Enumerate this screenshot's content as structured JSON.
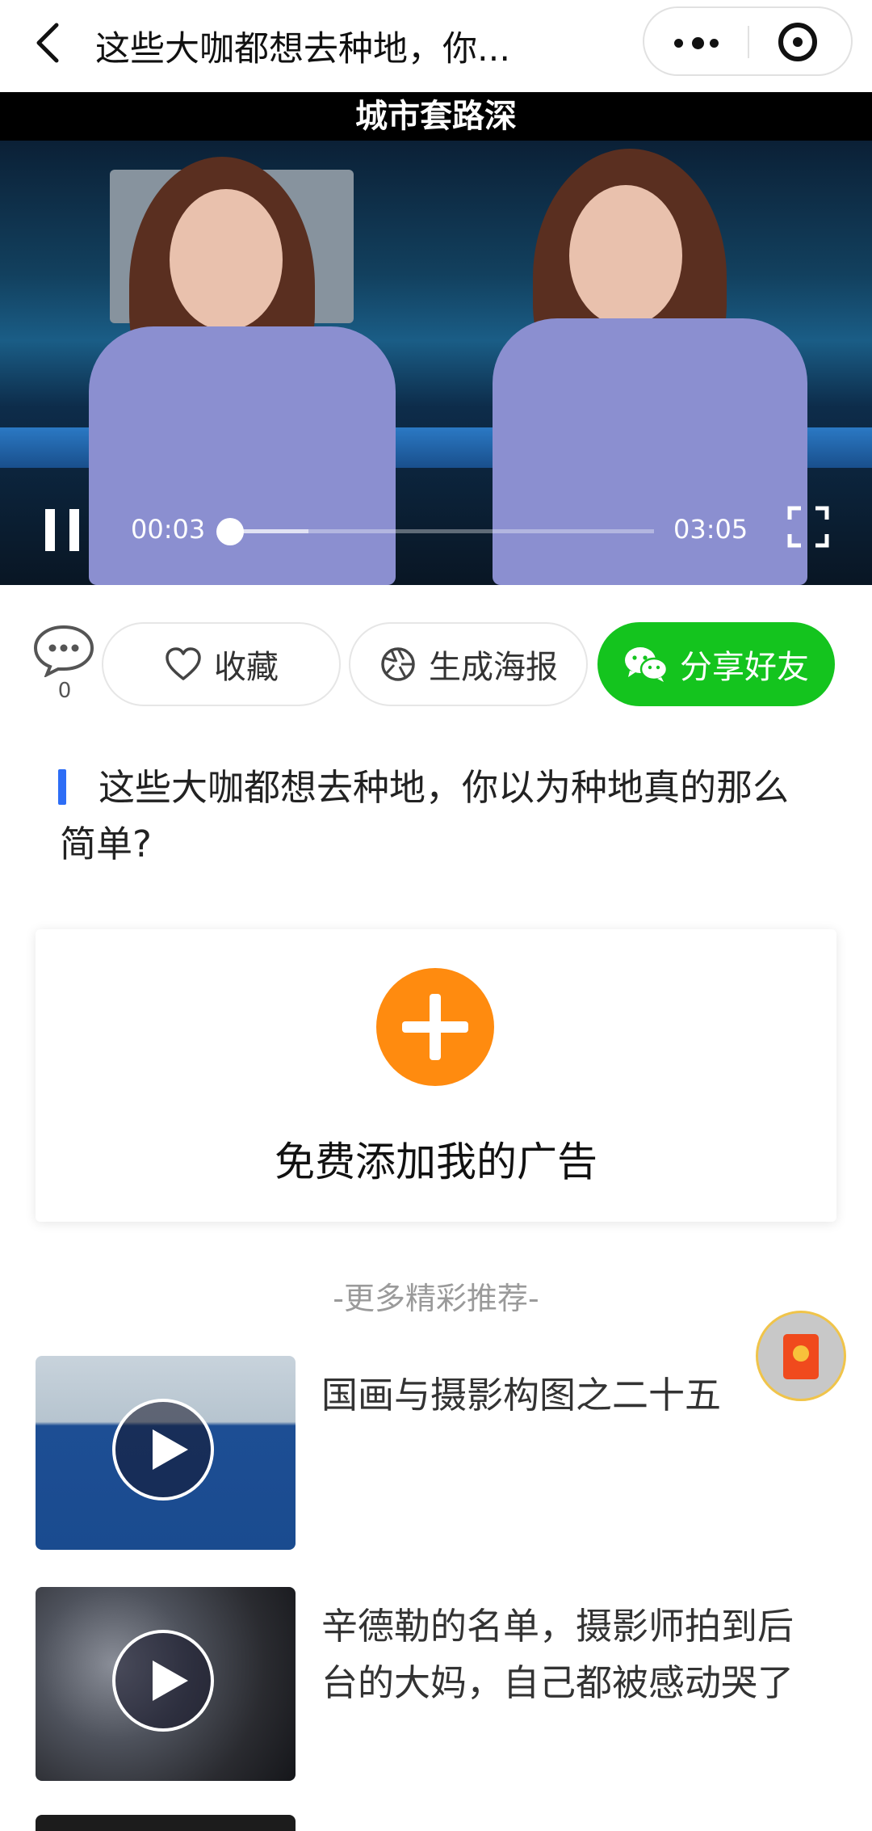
{
  "header": {
    "title": "这些大咖都想去种地，你...",
    "back_icon": "chevron-left-icon",
    "more_icon": "more-dots-icon",
    "target_icon": "target-icon"
  },
  "video": {
    "caption": "城市套路深",
    "current_time": "00:03",
    "duration": "03:05",
    "progress_fraction": 0.016,
    "state": "playing"
  },
  "actions": {
    "comment_count": "0",
    "favorite_label": "收藏",
    "poster_label": "生成海报",
    "share_label": "分享好友",
    "share_color": "#14c41e"
  },
  "article": {
    "title": "这些大咖都想去种地，你以为种地真的那么简单?",
    "marker_color": "#2d6df6"
  },
  "ad": {
    "label": "免费添加我的广告",
    "accent_color": "#ff8b0f"
  },
  "recommendations": {
    "heading": "-更多精彩推荐-",
    "items": [
      {
        "title": "国画与摄影构图之二十五"
      },
      {
        "title": "辛德勒的名单，摄影师拍到后台的大妈，自己都被感动哭了"
      }
    ]
  }
}
